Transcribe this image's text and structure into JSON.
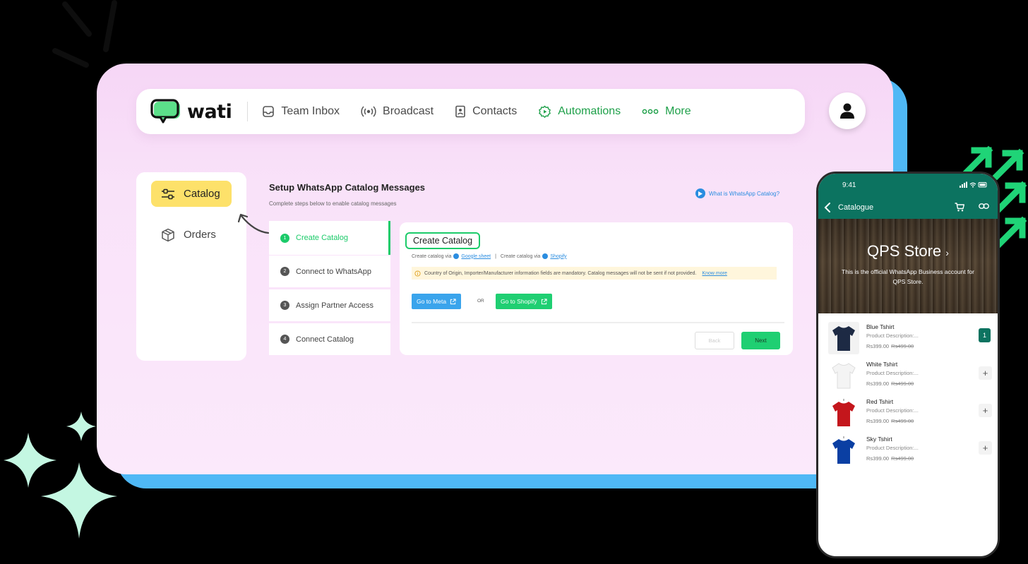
{
  "brand": {
    "name": "wati"
  },
  "nav": {
    "items": [
      {
        "label": "Team Inbox",
        "icon": "inbox-icon"
      },
      {
        "label": "Broadcast",
        "icon": "broadcast-icon"
      },
      {
        "label": "Contacts",
        "icon": "contacts-icon"
      },
      {
        "label": "Automations",
        "icon": "gear-icon"
      },
      {
        "label": "More",
        "icon": "more-dots-icon"
      }
    ]
  },
  "sidebar": {
    "items": [
      {
        "label": "Catalog",
        "icon": "sliders-icon",
        "active": true
      },
      {
        "label": "Orders",
        "icon": "box-icon",
        "active": false
      }
    ]
  },
  "setup": {
    "title": "Setup WhatsApp Catalog Messages",
    "subtitle": "Complete steps below to enable catalog messages",
    "help_link": "What is WhatsApp Catalog?"
  },
  "steps": [
    {
      "num": "1",
      "label": "Create Catalog",
      "active": true
    },
    {
      "num": "2",
      "label": "Connect to WhatsApp",
      "active": false
    },
    {
      "num": "3",
      "label": "Assign Partner Access",
      "active": false
    },
    {
      "num": "4",
      "label": "Connect Catalog",
      "active": false
    }
  ],
  "panel": {
    "title": "Create Catalog",
    "via_prefix_1": "Create catalog via",
    "via_link_1": "Google sheet",
    "via_separator": "|",
    "via_prefix_2": "Create catalog via",
    "via_link_2": "Shopify",
    "notice": "Country of Origin, Importer/Manufacturer information fields are mandatory. Catalog messages will not be sent if not provided.",
    "notice_link": "Know more",
    "btn_meta": "Go to Meta",
    "or": "OR",
    "btn_shopify": "Go to Shopify",
    "btn_back": "Back",
    "btn_next": "Next"
  },
  "phone": {
    "time": "9:41",
    "appbar_title": "Catalogue",
    "store_name": "QPS Store",
    "store_desc": "This is the official WhatsApp Business account for QPS Store.",
    "products": [
      {
        "name": "Blue Tshirt",
        "desc": "Product Description:...",
        "price": "Rs399.00",
        "old_price": "Rs499.00",
        "qty": "1",
        "color": "#1d2a44"
      },
      {
        "name": "White Tshirt",
        "desc": "Product Description:...",
        "price": "Rs399.00",
        "old_price": "Rs499.00",
        "qty": "",
        "color": "#f4f4f4"
      },
      {
        "name": "Red Tshirt",
        "desc": "Product Description:...",
        "price": "Rs399.00",
        "old_price": "Rs499.00",
        "qty": "",
        "color": "#c4161c"
      },
      {
        "name": "Sky Tshirt",
        "desc": "Product Description:...",
        "price": "Rs399.00",
        "old_price": "Rs499.00",
        "qty": "",
        "color": "#0a3fa3"
      }
    ]
  },
  "colors": {
    "accent_green": "#1ccb6a",
    "whatsapp_teal": "#0c7360",
    "catalog_active": "#fde16a",
    "link_blue": "#2b8de0"
  }
}
